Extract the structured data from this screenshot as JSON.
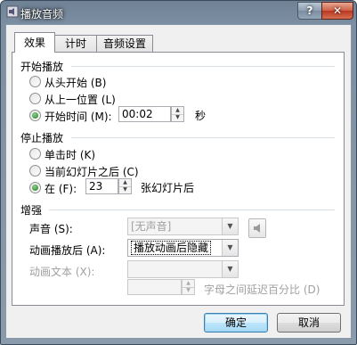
{
  "window": {
    "title": "播放音频",
    "help_label": "?",
    "close_label": "✕"
  },
  "tabs": [
    {
      "label": "效果"
    },
    {
      "label": "计时"
    },
    {
      "label": "音频设置"
    }
  ],
  "start_group": {
    "title": "开始播放",
    "options": [
      {
        "label": "从头开始 (B)",
        "checked": false
      },
      {
        "label": "从上一位置 (L)",
        "checked": false
      },
      {
        "label": "开始时间 (M):",
        "checked": true
      }
    ],
    "start_time_value": "00:02",
    "start_time_unit": "秒"
  },
  "stop_group": {
    "title": "停止播放",
    "options": [
      {
        "label": "单击时 (K)",
        "checked": false
      },
      {
        "label": "当前幻灯片之后 (C)",
        "checked": false
      },
      {
        "label": "在 (F):",
        "checked": true
      }
    ],
    "slides_value": "23",
    "slides_suffix": "张幻灯片后"
  },
  "enhance_group": {
    "title": "增强",
    "sound_label": "声音 (S):",
    "sound_value": "[无声音]",
    "after_animation_label": "动画播放后 (A):",
    "after_animation_value": "播放动画后隐藏",
    "animate_text_label": "动画文本 (X):",
    "animate_text_value": "",
    "delay_value": "",
    "delay_label": "字母之间延迟百分比 (D)"
  },
  "buttons": {
    "ok": "确定",
    "cancel": "取消"
  },
  "colors": {
    "title_bar": "#7c8fa2",
    "close_button": "#c8442a",
    "selected_radio": "#1e7a1e"
  },
  "icons": {
    "window": "speaker-icon",
    "sound": "speaker-icon"
  }
}
